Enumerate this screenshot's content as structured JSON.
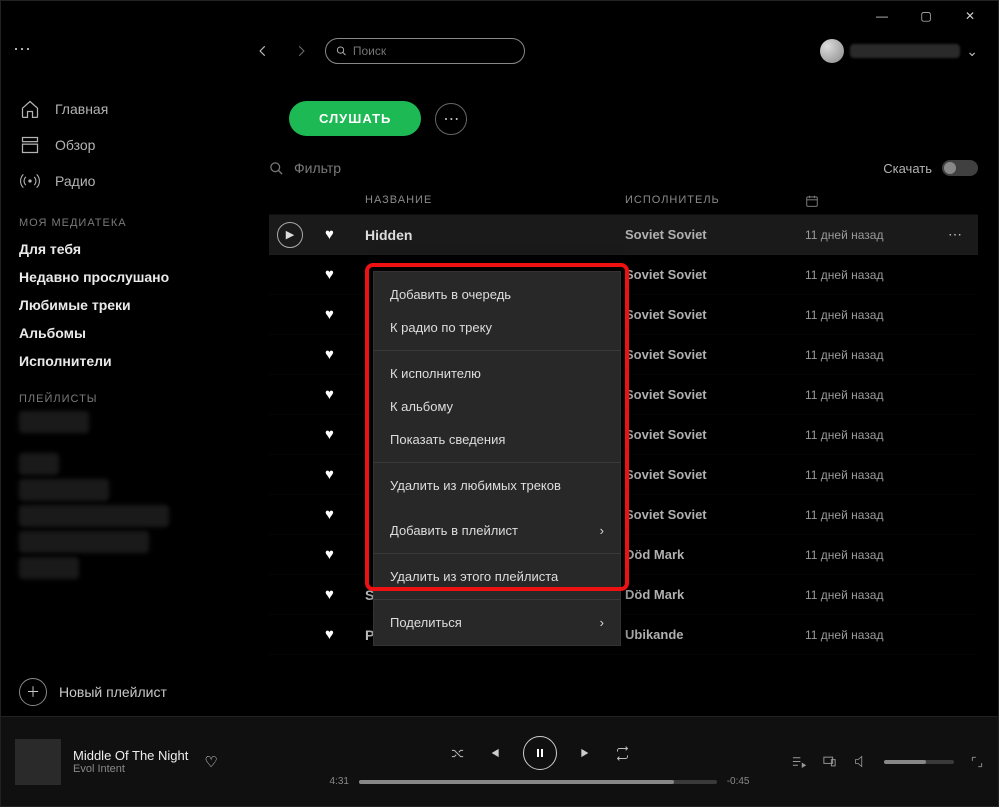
{
  "window_controls": {
    "min": "—",
    "max": "▢",
    "close": "✕"
  },
  "topbar": {
    "search_placeholder": "Поиск"
  },
  "sidebar": {
    "main_nav": [
      {
        "icon": "home-icon",
        "label": "Главная"
      },
      {
        "icon": "browse-icon",
        "label": "Обзор"
      },
      {
        "icon": "radio-icon",
        "label": "Радио"
      }
    ],
    "library_heading": "МОЯ МЕДИАТЕКА",
    "library_items": [
      "Для тебя",
      "Недавно прослушано",
      "Любимые треки",
      "Альбомы",
      "Исполнители"
    ],
    "playlists_heading": "ПЛЕЙЛИСТЫ",
    "new_playlist": "Новый плейлист"
  },
  "main": {
    "listen_btn": "СЛУШАТЬ",
    "filter_placeholder": "Фильтр",
    "download_label": "Скачать",
    "columns": {
      "title": "НАЗВАНИЕ",
      "artist": "ИСПОЛНИТЕЛЬ",
      "date": ""
    },
    "tracks": [
      {
        "title": "Hidden",
        "artist": "Soviet Soviet",
        "date": "11 дней назад"
      },
      {
        "title": "",
        "artist": "Soviet Soviet",
        "date": "11 дней назад"
      },
      {
        "title": "",
        "artist": "Soviet Soviet",
        "date": "11 дней назад"
      },
      {
        "title": "",
        "artist": "Soviet Soviet",
        "date": "11 дней назад"
      },
      {
        "title": "",
        "artist": "Soviet Soviet",
        "date": "11 дней назад"
      },
      {
        "title": "",
        "artist": "Soviet Soviet",
        "date": "11 дней назад"
      },
      {
        "title": "",
        "artist": "Soviet Soviet",
        "date": "11 дней назад"
      },
      {
        "title": "",
        "artist": "Soviet Soviet",
        "date": "11 дней назад"
      },
      {
        "title": "",
        "artist": "Död Mark",
        "date": "11 дней назад"
      },
      {
        "title": "Svarta havet",
        "artist": "Död Mark",
        "date": "11 дней назад"
      },
      {
        "title": "Panca",
        "artist": "Ubikande",
        "date": "11 дней назад"
      }
    ]
  },
  "context_menu": {
    "groups": [
      [
        "Добавить в очередь",
        "К радио по треку"
      ],
      [
        "К исполнителю",
        "К альбому",
        "Показать сведения"
      ],
      [
        "Удалить из любимых треков"
      ]
    ],
    "submenu": [
      {
        "label": "Добавить в плейлист",
        "has_sub": true
      }
    ],
    "groups2": [
      [
        "Удалить из этого плейлиста"
      ]
    ],
    "submenu2": [
      {
        "label": "Поделиться",
        "has_sub": true
      }
    ]
  },
  "player": {
    "title": "Middle Of The Night",
    "artist": "Evol Intent",
    "elapsed": "4:31",
    "remaining": "-0:45"
  }
}
